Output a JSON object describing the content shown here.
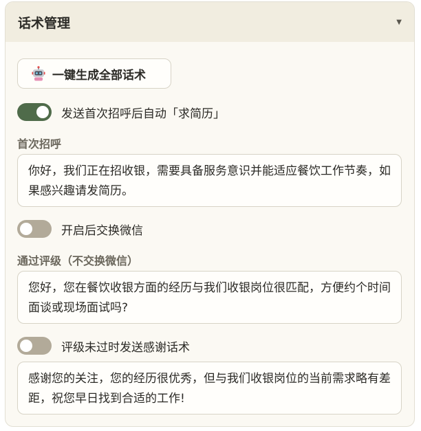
{
  "panel": {
    "title": "话术管理",
    "collapse_icon": "caret-down-icon"
  },
  "generate_button": {
    "label": "一键生成全部话术",
    "icon": "robot-icon"
  },
  "toggle_request_resume": {
    "label": "发送首次招呼后自动「求简历」",
    "on": true
  },
  "first_greeting": {
    "label": "首次招呼",
    "text": "你好，我们正在招收银，需要具备服务意识并能适应餐饮工作节奏，如果感兴趣请发简历。"
  },
  "toggle_exchange_wechat": {
    "label": "开启后交换微信",
    "on": false
  },
  "pass_rating": {
    "label": "通过评级（不交换微信）",
    "text": "您好，您在餐饮收银方面的经历与我们收银岗位很匹配，方便约个时间面谈或现场面试吗?"
  },
  "toggle_thanks": {
    "label": "评级未过时发送感谢话术",
    "on": false
  },
  "thanks_message": {
    "text": "感谢您的关注，您的经历很优秀，但与我们收银岗位的当前需求略有差距，祝您早日找到合适的工作!"
  },
  "colors": {
    "toggle_on": "#4f6b4a",
    "toggle_off": "#b2aa99",
    "header_bg": "#f1ede0",
    "panel_bg": "#fbf9f3"
  }
}
